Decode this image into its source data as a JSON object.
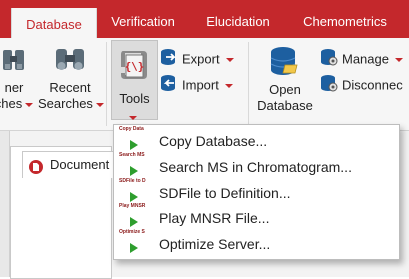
{
  "tabs": [
    {
      "label": "Database",
      "active": true
    },
    {
      "label": "Verification",
      "active": false
    },
    {
      "label": "Elucidation",
      "active": false
    },
    {
      "label": "Chemometrics",
      "active": false
    }
  ],
  "ribbon": {
    "left_partial": {
      "line1": "ner",
      "line2": "ches"
    },
    "recent_searches": {
      "line1": "Recent",
      "line2": "Searches"
    },
    "tools": {
      "label": "Tools"
    },
    "export": {
      "label": "Export"
    },
    "import": {
      "label": "Import"
    },
    "open_database": {
      "line1": "Open",
      "line2": "Database"
    },
    "manage": {
      "label": "Manage"
    },
    "disconnect": {
      "label": "Disconnec"
    }
  },
  "document_tab": {
    "label": "Document"
  },
  "menu": {
    "items": [
      {
        "tiny": "Copy Data",
        "label": "Copy Database..."
      },
      {
        "tiny": "Search MS",
        "label": "Search MS in Chromatogram..."
      },
      {
        "tiny": "SDFile to D",
        "label": "SDFile to Definition..."
      },
      {
        "tiny": "Play MNSR",
        "label": "Play MNSR File..."
      },
      {
        "tiny": "Optimize S",
        "label": "Optimize Server..."
      }
    ]
  },
  "colors": {
    "accent": "#c4282c",
    "play": "#2e9e2e",
    "db_blue": "#1d5fa0"
  }
}
